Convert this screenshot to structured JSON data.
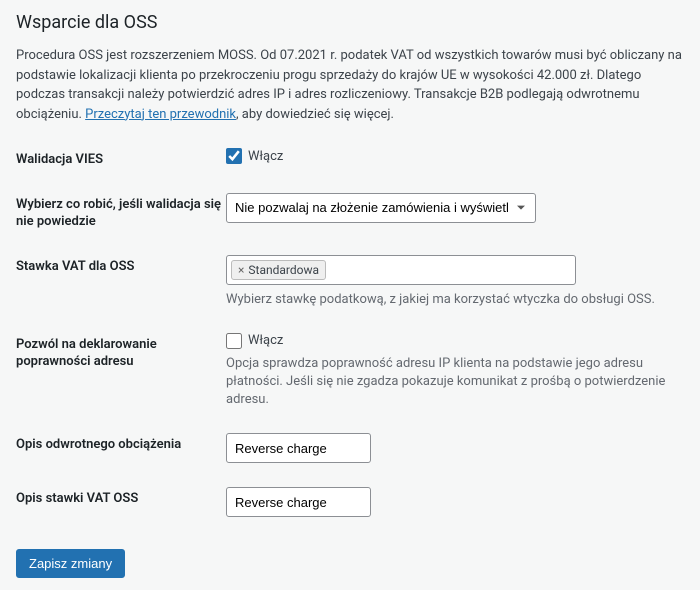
{
  "heading": "Wsparcie dla OSS",
  "intro": {
    "text_before_link": "Procedura OSS jest rozszerzeniem MOSS. Od 07.2021 r. podatek VAT od wszystkich towarów musi być obliczany na podstawie lokalizacji klienta po przekroczeniu progu sprzedaży do krajów UE w wysokości 42.000 zł. Dlatego podczas transakcji należy potwierdzić adres IP i adres rozliczeniowy. Transakcje B2B podlegają odwrotnemu obciążeniu. ",
    "link_text": "Przeczytaj ten przewodnik",
    "text_after_link": ", aby dowiedzieć się więcej."
  },
  "fields": {
    "vies_validation": {
      "label": "Walidacja VIES",
      "checkbox_label": "Włącz",
      "checked": true
    },
    "validation_fail": {
      "label": "Wybierz co robić, jeśli walidacja się nie powiedzie",
      "selected": "Nie pozwalaj na złożenie zamówienia i wyświetl komunikat"
    },
    "vat_rate": {
      "label": "Stawka VAT dla OSS",
      "tag": "Standardowa",
      "description": "Wybierz stawkę podatkową, z jakiej ma korzystać wtyczka do obsługi OSS."
    },
    "allow_declare": {
      "label": "Pozwól na deklarowanie poprawności adresu",
      "checkbox_label": "Włącz",
      "checked": false,
      "description": "Opcja sprawdza poprawność adresu IP klienta na podstawie jego adresu płatności. Jeśli się nie zgadza pokazuje komunikat z prośbą o potwierdzenie adresu."
    },
    "reverse_charge_desc": {
      "label": "Opis odwrotnego obciążenia",
      "value": "Reverse charge"
    },
    "vat_rate_desc": {
      "label": "Opis stawki VAT OSS",
      "value": "Reverse charge"
    }
  },
  "submit_label": "Zapisz zmiany"
}
